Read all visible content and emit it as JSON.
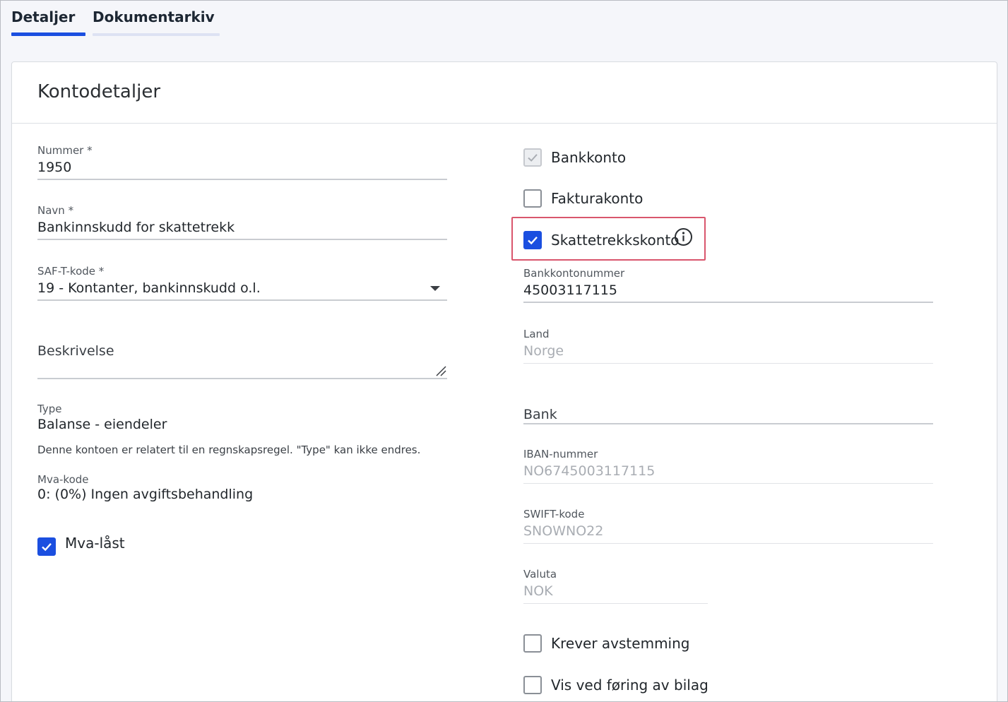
{
  "tabs": [
    {
      "label": "Detaljer",
      "active": true
    },
    {
      "label": "Dokumentarkiv",
      "active": false
    }
  ],
  "colors": {
    "accent": "#1b4fe0",
    "highlight": "#d9566d",
    "disabled_text": "#a9adb3"
  },
  "card": {
    "title": "Kontodetaljer"
  },
  "left": {
    "nummer": {
      "label": "Nummer *",
      "value": "1950"
    },
    "navn": {
      "label": "Navn *",
      "value": "Bankinnskudd for skattetrekk"
    },
    "saft": {
      "label": "SAF-T-kode *",
      "value": "19 - Kontanter, bankinnskudd o.l.",
      "icon": "chevron-down-icon"
    },
    "beskrivelse": {
      "placeholder": "Beskrivelse"
    },
    "type": {
      "label": "Type",
      "value": "Balanse - eiendeler",
      "note": "Denne kontoen er relatert til en regnskapsregel. \"Type\" kan ikke endres."
    },
    "mva": {
      "label": "Mva-kode",
      "value": "0: (0%) Ingen avgiftsbehandling"
    },
    "mva_locked": {
      "label": "Mva-låst",
      "checked": true
    }
  },
  "right": {
    "bankkonto": {
      "label": "Bankkonto",
      "checked": true,
      "disabled": true
    },
    "fakturakonto": {
      "label": "Fakturakonto",
      "checked": false
    },
    "skattetrekkskonto": {
      "label": "Skattetrekkskonto",
      "checked": true,
      "icon": "info-icon"
    },
    "bankkontonummer": {
      "label": "Bankkontonummer",
      "value": "45003117115"
    },
    "land": {
      "label": "Land",
      "value": "Norge"
    },
    "bank": {
      "placeholder": "Bank"
    },
    "iban": {
      "label": "IBAN-nummer",
      "value": "NO6745003117115"
    },
    "swift": {
      "label": "SWIFT-kode",
      "value": "SNOWNO22"
    },
    "valuta": {
      "label": "Valuta",
      "value": "NOK"
    },
    "krever_avstemming": {
      "label": "Krever avstemming",
      "checked": false
    },
    "vis_ved_foring": {
      "label": "Vis ved føring av bilag",
      "checked": false
    }
  }
}
